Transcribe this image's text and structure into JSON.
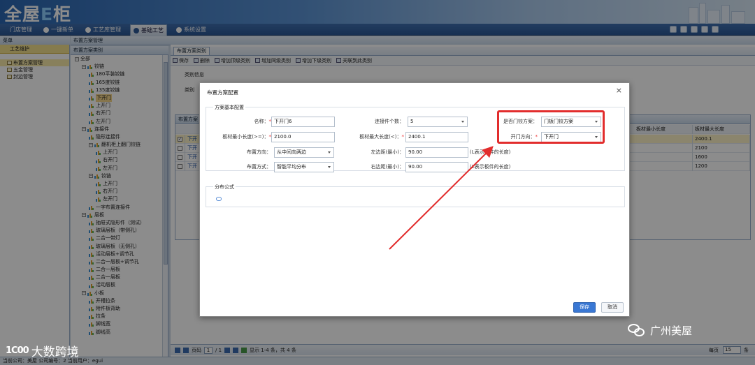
{
  "app": {
    "logo_main": "全屋",
    "logo_e": "E",
    "logo_tail": "柜"
  },
  "menu": [
    {
      "label": "门店管理"
    },
    {
      "label": "一键新单"
    },
    {
      "label": "工艺库管理"
    },
    {
      "label": "基础工艺"
    },
    {
      "label": "系统设置"
    }
  ],
  "panels": {
    "menu_title": "菜单",
    "layout_mgmt": "布置方案管理",
    "layout_category": "布置方案类别",
    "tab_category": "布置方案类别",
    "category_info": "类别信息",
    "category_label_partial": "类别",
    "grid_title_partial": "布置方案"
  },
  "leftnav": {
    "head": "工艺维护",
    "items": [
      "布置方案管理",
      "五金管理",
      "封边管理"
    ]
  },
  "toolbar": [
    "保存",
    "删除",
    "增加顶级类别",
    "增加同级类别",
    "增加下级类别",
    "关联到此类别"
  ],
  "tree": [
    {
      "d": 0,
      "t": "全部",
      "exp": "−",
      "ic": false
    },
    {
      "d": 1,
      "t": "铰链",
      "exp": "−",
      "ic": true
    },
    {
      "d": 2,
      "t": "180平装铰链",
      "ic": true
    },
    {
      "d": 2,
      "t": "165度铰链",
      "ic": true
    },
    {
      "d": 2,
      "t": "135度铰链",
      "ic": true
    },
    {
      "d": 2,
      "t": "下开门",
      "ic": true,
      "sel": true
    },
    {
      "d": 2,
      "t": "上开门",
      "ic": true
    },
    {
      "d": 2,
      "t": "右开门",
      "ic": true
    },
    {
      "d": 2,
      "t": "左开门",
      "ic": true
    },
    {
      "d": 1,
      "t": "连接件",
      "exp": "−",
      "ic": true
    },
    {
      "d": 2,
      "t": "隐形连接件",
      "ic": true
    },
    {
      "d": 2,
      "t": "翻机柜上翻门铰链",
      "exp": "−",
      "ic": true
    },
    {
      "d": 3,
      "t": "上开门",
      "ic": true
    },
    {
      "d": 3,
      "t": "右开门",
      "ic": true
    },
    {
      "d": 3,
      "t": "左开门",
      "ic": true
    },
    {
      "d": 2,
      "t": "铰链",
      "exp": "−",
      "ic": true
    },
    {
      "d": 3,
      "t": "上开门",
      "ic": true
    },
    {
      "d": 3,
      "t": "右开门",
      "ic": true
    },
    {
      "d": 3,
      "t": "左开门",
      "ic": true
    },
    {
      "d": 2,
      "t": "一字布置连接件",
      "ic": true
    },
    {
      "d": 1,
      "t": "层板",
      "exp": "−",
      "ic": true
    },
    {
      "d": 2,
      "t": "抽屉式隐形件（测试）",
      "ic": true
    },
    {
      "d": 2,
      "t": "玻璃层板（带侧孔）",
      "ic": true
    },
    {
      "d": 2,
      "t": "二合一带灯",
      "ic": true
    },
    {
      "d": 2,
      "t": "玻璃层板（无侧孔）",
      "ic": true
    },
    {
      "d": 2,
      "t": "活动层板+调节孔",
      "ic": true
    },
    {
      "d": 2,
      "t": "二合一层板+调节孔",
      "ic": true
    },
    {
      "d": 2,
      "t": "二合一层板",
      "ic": true
    },
    {
      "d": 2,
      "t": "二合一层板",
      "ic": true
    },
    {
      "d": 2,
      "t": "活动层板",
      "ic": true
    },
    {
      "d": 1,
      "t": "小板",
      "exp": "−",
      "ic": true
    },
    {
      "d": 2,
      "t": "开槽拉条",
      "ic": true
    },
    {
      "d": 2,
      "t": "附件板背助",
      "ic": true
    },
    {
      "d": 2,
      "t": "拉条",
      "ic": true
    },
    {
      "d": 2,
      "t": "脚线宽",
      "ic": true
    },
    {
      "d": 2,
      "t": "脚线高",
      "ic": true
    }
  ],
  "grid": {
    "cols": [
      "板材最小长度",
      "板材最大长度"
    ],
    "rows": [
      {
        "name": "下开",
        "min": "",
        "max": "2400.1",
        "checked": true
      },
      {
        "name": "下开",
        "min": "",
        "max": "2100",
        "checked": false
      },
      {
        "name": "下开",
        "min": "",
        "max": "1600",
        "checked": false
      },
      {
        "name": "下开",
        "min": "",
        "max": "1200",
        "checked": false
      }
    ]
  },
  "pager": {
    "page_label": "页码",
    "page": "1",
    "total_pages": "/ 1",
    "range": "显示 1-4 条，共 4 条",
    "per_page_label": "每页",
    "per_page": "15",
    "count_mark": "条"
  },
  "statusbar": "当前公司：美屋  公司编号：2  当前用户：egui",
  "dialog": {
    "title": "布置方案配置",
    "close": "×",
    "section_basic": "方案基本配置",
    "section_formula": "分布公式",
    "name_label": "名称：",
    "name_value": "下开门6",
    "conn_count_label": "连接件个数：",
    "conn_count_value": "5",
    "is_door_label": "是否门铰方案：",
    "is_door_value": "门板门铰方案",
    "min_len_label": "板材最小长度(>=)：",
    "min_len_value": "2100.0",
    "max_len_label": "板材最大长度(<)：",
    "max_len_value": "2400.1",
    "open_dir_label": "开门方向：",
    "open_dir_value": "下开门",
    "layout_dir_label": "布置方向：",
    "layout_dir_value": "从中间向两边",
    "left_margin_label": "左边距(最小)：",
    "left_margin_value": "90.00",
    "left_margin_hint": "(L表示板件的长度)",
    "layout_mode_label": "布置方式：",
    "layout_mode_value": "智能平均分布",
    "right_margin_label": "右边距(最小)：",
    "right_margin_value": "90.00",
    "right_margin_hint": "(L表示板件的长度)",
    "save": "保存",
    "cancel": "取消"
  },
  "watermarks": {
    "right": "广州美屋",
    "left_logo": "1C00",
    "left": "大数跨境"
  },
  "colors": {
    "highlight": "#e22d2d",
    "primary": "#3a78d4",
    "menu": "#2c5896"
  }
}
